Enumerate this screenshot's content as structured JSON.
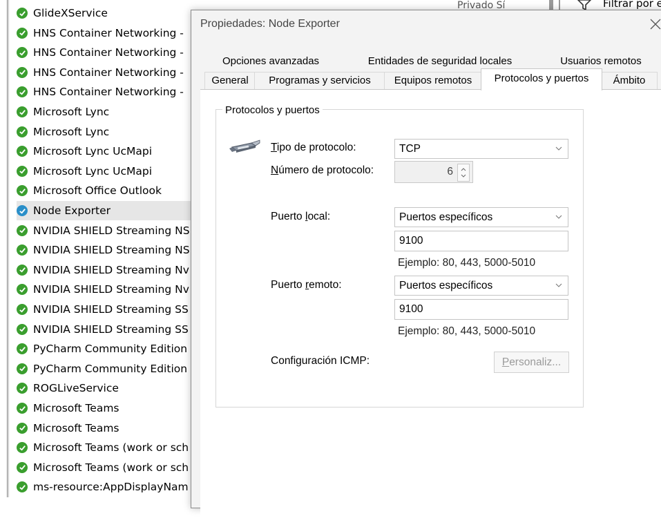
{
  "background_list": {
    "rules": [
      {
        "label": "GlideXService",
        "selected": false
      },
      {
        "label": "HNS Container Networking -",
        "selected": false
      },
      {
        "label": "HNS Container Networking -",
        "selected": false
      },
      {
        "label": "HNS Container Networking -",
        "selected": false
      },
      {
        "label": "HNS Container Networking -",
        "selected": false
      },
      {
        "label": "Microsoft Lync",
        "selected": false
      },
      {
        "label": "Microsoft Lync",
        "selected": false
      },
      {
        "label": "Microsoft Lync UcMapi",
        "selected": false
      },
      {
        "label": "Microsoft Lync UcMapi",
        "selected": false
      },
      {
        "label": "Microsoft Office Outlook",
        "selected": false
      },
      {
        "label": "Node Exporter",
        "selected": true
      },
      {
        "label": "NVIDIA SHIELD Streaming NS",
        "selected": false
      },
      {
        "label": "NVIDIA SHIELD Streaming NS",
        "selected": false
      },
      {
        "label": "NVIDIA SHIELD Streaming Nv",
        "selected": false
      },
      {
        "label": "NVIDIA SHIELD Streaming Nv",
        "selected": false
      },
      {
        "label": "NVIDIA SHIELD Streaming SS",
        "selected": false
      },
      {
        "label": "NVIDIA SHIELD Streaming SS",
        "selected": false
      },
      {
        "label": "PyCharm Community Edition",
        "selected": false
      },
      {
        "label": "PyCharm Community Edition",
        "selected": false
      },
      {
        "label": "ROGLiveService",
        "selected": false
      },
      {
        "label": "Microsoft Teams",
        "selected": false
      },
      {
        "label": "Microsoft Teams",
        "selected": false
      },
      {
        "label": "Microsoft Teams (work or sch",
        "selected": false
      },
      {
        "label": "Microsoft Teams (work or sch",
        "selected": false
      },
      {
        "label": "ms-resource:AppDisplayNam",
        "selected": false
      }
    ],
    "check_color": "#3a9e2e",
    "selected_check_color": "#2a8fc9"
  },
  "filter_strip": {
    "label": "Filtrar por e",
    "peek_text": "Privado    Sí"
  },
  "dialog": {
    "title": "Propiedades: Node Exporter",
    "close_icon": "close-icon",
    "tabs_row1": [
      "Opciones avanzadas",
      "Entidades de seguridad locales",
      "Usuarios remotos"
    ],
    "tabs_row2": [
      "General",
      "Programas y servicios",
      "Equipos remotos",
      "Protocolos y puertos",
      "Ámbito"
    ],
    "active_tab": "Protocolos y puertos",
    "group_title": "Protocolos y puertos",
    "protocol_type": {
      "label_prefix": "",
      "label_mnemonic": "T",
      "label_rest": "ipo de protocolo:",
      "value": "TCP"
    },
    "protocol_number": {
      "label_mnemonic": "N",
      "label_rest": "úmero de protocolo:",
      "value": "6"
    },
    "local_port": {
      "label_prefix": "Puerto ",
      "label_mnemonic": "l",
      "label_rest": "ocal:",
      "mode": "Puertos específicos",
      "value": "9100",
      "example": "Ejemplo: 80, 443, 5000-5010"
    },
    "remote_port": {
      "label_prefix": "Puerto ",
      "label_mnemonic": "r",
      "label_rest": "emoto:",
      "mode": "Puertos específicos",
      "value": "9100",
      "example": "Ejemplo: 80, 443, 5000-5010"
    },
    "icmp": {
      "label": "Configuración ICMP:",
      "button_mnemonic": "P",
      "button_rest": "ersonaliz..."
    }
  }
}
